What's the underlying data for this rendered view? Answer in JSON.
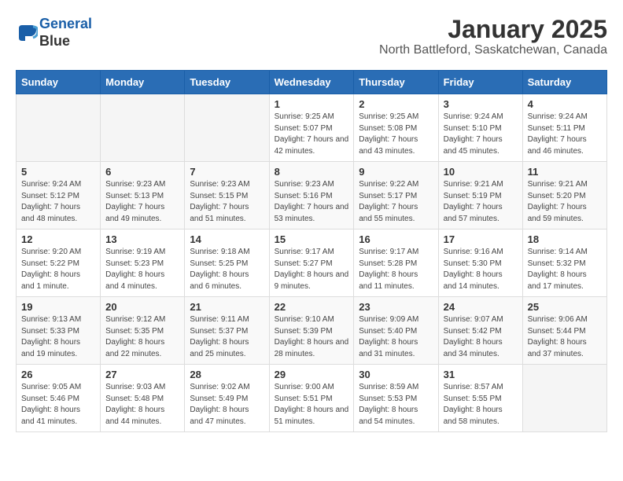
{
  "header": {
    "logo_line1": "General",
    "logo_line2": "Blue",
    "title": "January 2025",
    "subtitle": "North Battleford, Saskatchewan, Canada"
  },
  "weekdays": [
    "Sunday",
    "Monday",
    "Tuesday",
    "Wednesday",
    "Thursday",
    "Friday",
    "Saturday"
  ],
  "weeks": [
    [
      {
        "day": "",
        "info": ""
      },
      {
        "day": "",
        "info": ""
      },
      {
        "day": "",
        "info": ""
      },
      {
        "day": "1",
        "info": "Sunrise: 9:25 AM\nSunset: 5:07 PM\nDaylight: 7 hours and 42 minutes."
      },
      {
        "day": "2",
        "info": "Sunrise: 9:25 AM\nSunset: 5:08 PM\nDaylight: 7 hours and 43 minutes."
      },
      {
        "day": "3",
        "info": "Sunrise: 9:24 AM\nSunset: 5:10 PM\nDaylight: 7 hours and 45 minutes."
      },
      {
        "day": "4",
        "info": "Sunrise: 9:24 AM\nSunset: 5:11 PM\nDaylight: 7 hours and 46 minutes."
      }
    ],
    [
      {
        "day": "5",
        "info": "Sunrise: 9:24 AM\nSunset: 5:12 PM\nDaylight: 7 hours and 48 minutes."
      },
      {
        "day": "6",
        "info": "Sunrise: 9:23 AM\nSunset: 5:13 PM\nDaylight: 7 hours and 49 minutes."
      },
      {
        "day": "7",
        "info": "Sunrise: 9:23 AM\nSunset: 5:15 PM\nDaylight: 7 hours and 51 minutes."
      },
      {
        "day": "8",
        "info": "Sunrise: 9:23 AM\nSunset: 5:16 PM\nDaylight: 7 hours and 53 minutes."
      },
      {
        "day": "9",
        "info": "Sunrise: 9:22 AM\nSunset: 5:17 PM\nDaylight: 7 hours and 55 minutes."
      },
      {
        "day": "10",
        "info": "Sunrise: 9:21 AM\nSunset: 5:19 PM\nDaylight: 7 hours and 57 minutes."
      },
      {
        "day": "11",
        "info": "Sunrise: 9:21 AM\nSunset: 5:20 PM\nDaylight: 7 hours and 59 minutes."
      }
    ],
    [
      {
        "day": "12",
        "info": "Sunrise: 9:20 AM\nSunset: 5:22 PM\nDaylight: 8 hours and 1 minute."
      },
      {
        "day": "13",
        "info": "Sunrise: 9:19 AM\nSunset: 5:23 PM\nDaylight: 8 hours and 4 minutes."
      },
      {
        "day": "14",
        "info": "Sunrise: 9:18 AM\nSunset: 5:25 PM\nDaylight: 8 hours and 6 minutes."
      },
      {
        "day": "15",
        "info": "Sunrise: 9:17 AM\nSunset: 5:27 PM\nDaylight: 8 hours and 9 minutes."
      },
      {
        "day": "16",
        "info": "Sunrise: 9:17 AM\nSunset: 5:28 PM\nDaylight: 8 hours and 11 minutes."
      },
      {
        "day": "17",
        "info": "Sunrise: 9:16 AM\nSunset: 5:30 PM\nDaylight: 8 hours and 14 minutes."
      },
      {
        "day": "18",
        "info": "Sunrise: 9:14 AM\nSunset: 5:32 PM\nDaylight: 8 hours and 17 minutes."
      }
    ],
    [
      {
        "day": "19",
        "info": "Sunrise: 9:13 AM\nSunset: 5:33 PM\nDaylight: 8 hours and 19 minutes."
      },
      {
        "day": "20",
        "info": "Sunrise: 9:12 AM\nSunset: 5:35 PM\nDaylight: 8 hours and 22 minutes."
      },
      {
        "day": "21",
        "info": "Sunrise: 9:11 AM\nSunset: 5:37 PM\nDaylight: 8 hours and 25 minutes."
      },
      {
        "day": "22",
        "info": "Sunrise: 9:10 AM\nSunset: 5:39 PM\nDaylight: 8 hours and 28 minutes."
      },
      {
        "day": "23",
        "info": "Sunrise: 9:09 AM\nSunset: 5:40 PM\nDaylight: 8 hours and 31 minutes."
      },
      {
        "day": "24",
        "info": "Sunrise: 9:07 AM\nSunset: 5:42 PM\nDaylight: 8 hours and 34 minutes."
      },
      {
        "day": "25",
        "info": "Sunrise: 9:06 AM\nSunset: 5:44 PM\nDaylight: 8 hours and 37 minutes."
      }
    ],
    [
      {
        "day": "26",
        "info": "Sunrise: 9:05 AM\nSunset: 5:46 PM\nDaylight: 8 hours and 41 minutes."
      },
      {
        "day": "27",
        "info": "Sunrise: 9:03 AM\nSunset: 5:48 PM\nDaylight: 8 hours and 44 minutes."
      },
      {
        "day": "28",
        "info": "Sunrise: 9:02 AM\nSunset: 5:49 PM\nDaylight: 8 hours and 47 minutes."
      },
      {
        "day": "29",
        "info": "Sunrise: 9:00 AM\nSunset: 5:51 PM\nDaylight: 8 hours and 51 minutes."
      },
      {
        "day": "30",
        "info": "Sunrise: 8:59 AM\nSunset: 5:53 PM\nDaylight: 8 hours and 54 minutes."
      },
      {
        "day": "31",
        "info": "Sunrise: 8:57 AM\nSunset: 5:55 PM\nDaylight: 8 hours and 58 minutes."
      },
      {
        "day": "",
        "info": ""
      }
    ]
  ]
}
